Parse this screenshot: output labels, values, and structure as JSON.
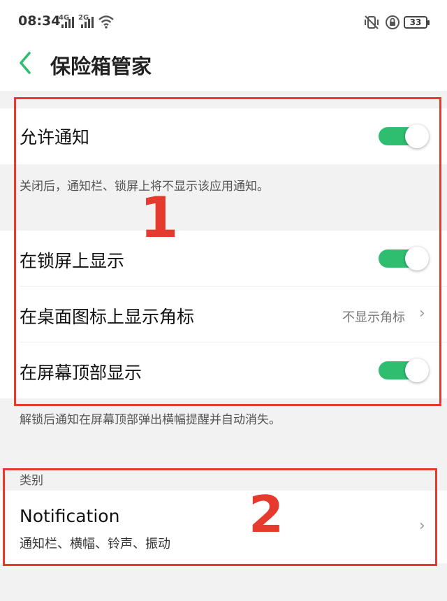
{
  "status_bar": {
    "time": "08:34",
    "net1": "4G",
    "net2": "2G",
    "battery": "33"
  },
  "header": {
    "title": "保险箱管家",
    "back_icon": "chevron-left-icon"
  },
  "group1": {
    "allow_notify": {
      "label": "允许通知",
      "on": true
    },
    "allow_notify_hint": "关闭后，通知栏、锁屏上将不显示该应用通知。"
  },
  "group2": {
    "lockscreen": {
      "label": "在锁屏上显示",
      "on": true
    },
    "badge": {
      "label": "在桌面图标上显示角标",
      "value": "不显示角标"
    },
    "top_display": {
      "label": "在屏幕顶部显示",
      "on": true
    },
    "top_display_hint": "解锁后通知在屏幕顶部弹出横幅提醒并自动消失。"
  },
  "category": {
    "label": "类别",
    "item": {
      "title": "Notification",
      "subtitle": "通知栏、横幅、铃声、振动"
    }
  },
  "annotations": {
    "one": "1",
    "two": "2"
  },
  "colors": {
    "accent": "#2fbe6f",
    "annotation": "#e63a2e",
    "back": "#2fbe6f"
  }
}
